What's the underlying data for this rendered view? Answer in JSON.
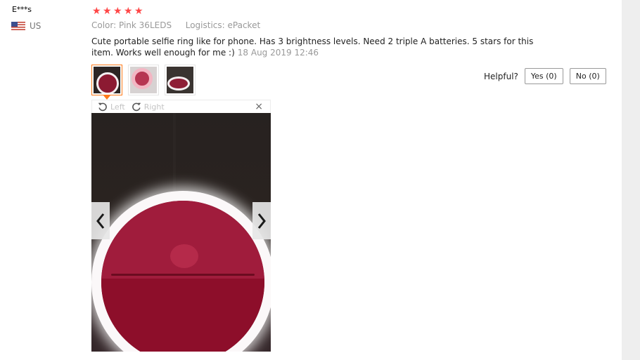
{
  "reviewer": {
    "name": "E***s",
    "country": "US",
    "flag_icon": "us-flag-icon"
  },
  "rating": {
    "stars": 5,
    "star_color": "#ff4747",
    "glyphs": [
      "★",
      "★",
      "★",
      "★",
      "★"
    ]
  },
  "meta": {
    "color_label": "Color:",
    "color_value": "Pink 36LEDS",
    "logistics_label": "Logistics:",
    "logistics_value": "ePacket"
  },
  "review": {
    "text": "Cute portable selfie ring like for phone. Has 3 brightness levels. Need 2 triple A batteries. 5 stars for this item. Works well enough for me :)",
    "date": "18 Aug 2019 12:46"
  },
  "thumbnails": [
    {
      "selected": true
    },
    {
      "selected": false
    },
    {
      "selected": false
    }
  ],
  "helpful": {
    "label": "Helpful?",
    "yes_label": "Yes (0)",
    "no_label": "No (0)"
  },
  "viewer": {
    "rotate_left_label": "Left",
    "rotate_right_label": "Right",
    "close_glyph": "×",
    "accent_color": "#ff7a1a"
  }
}
